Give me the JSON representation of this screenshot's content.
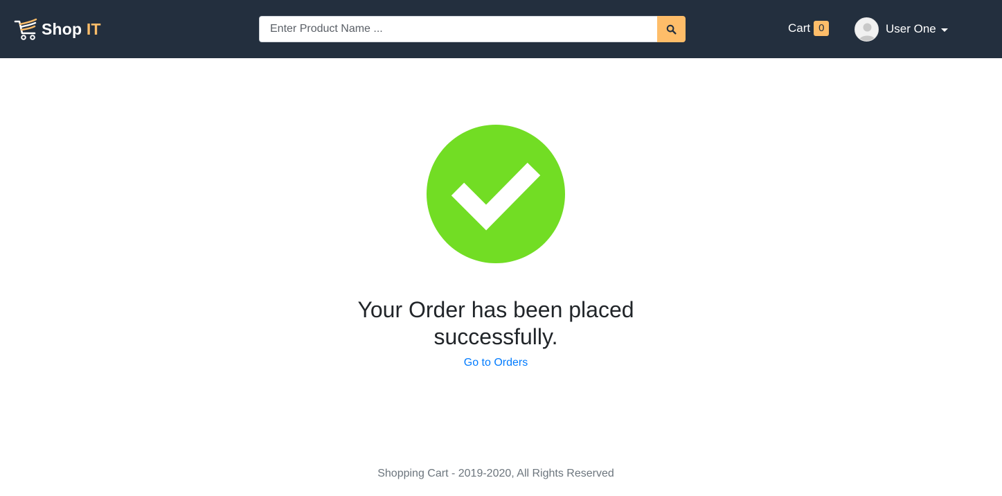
{
  "header": {
    "brand": {
      "name": "Shop",
      "accent": "IT"
    },
    "search": {
      "placeholder": "Enter Product Name ...",
      "value": "",
      "button_icon": "search-icon"
    },
    "cart": {
      "label": "Cart",
      "count": "0"
    },
    "user": {
      "name": "User One",
      "avatar_icon": "user-avatar-icon"
    }
  },
  "main": {
    "status_icon": "check-circle-icon",
    "message_line1": "Your Order has been placed",
    "message_line2": "successfully.",
    "link_label": "Go to Orders"
  },
  "footer": {
    "text": "Shopping Cart - 2019-2020, All Rights Reserved"
  },
  "colors": {
    "navbar": "#232f3e",
    "accent": "#febd69",
    "success": "#72dd24",
    "link": "#007bff"
  }
}
